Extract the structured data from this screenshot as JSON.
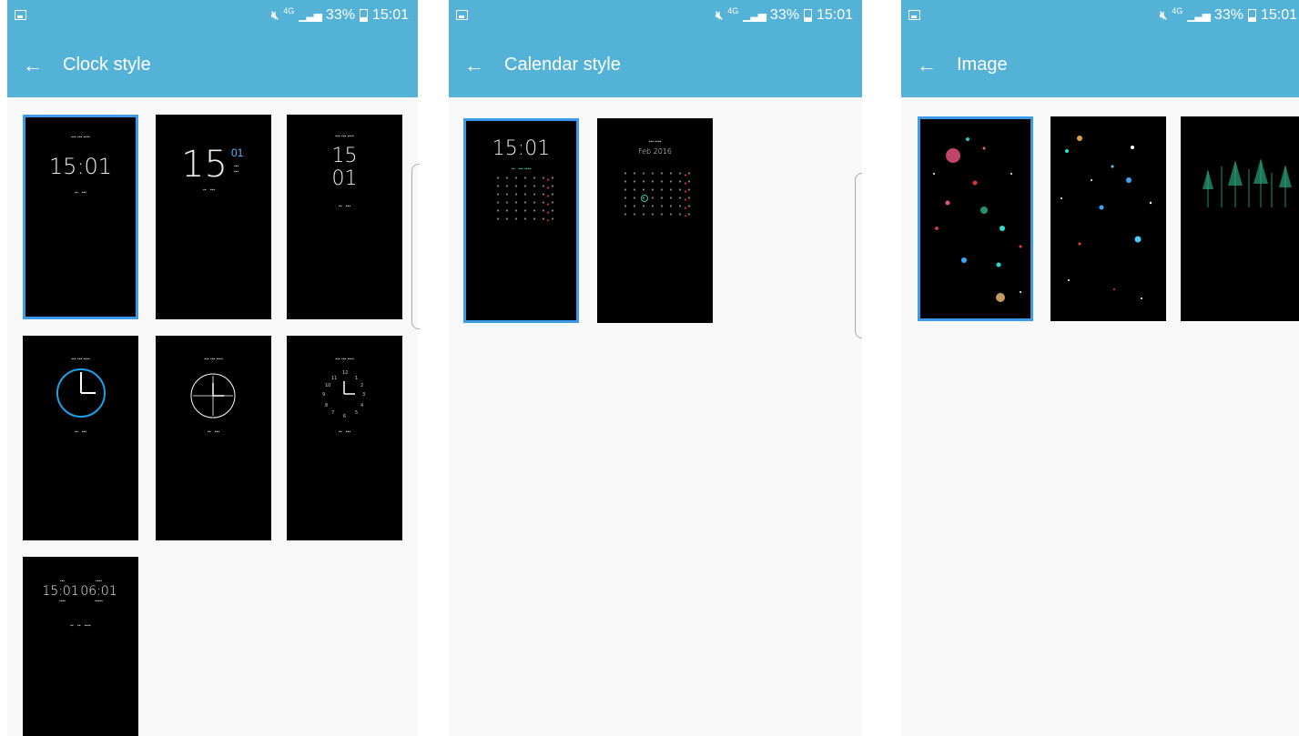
{
  "status_bar": {
    "time": "15:01",
    "battery": "33%",
    "network": "4G"
  },
  "colors": {
    "accent": "#55b2d7",
    "selection": "#3b9bea"
  },
  "screens": [
    {
      "title": "Clock style",
      "back_icon": "arrow-left-icon",
      "thumbnail_count": 7,
      "selected_index": 0
    },
    {
      "title": "Calendar style",
      "back_icon": "arrow-left-icon",
      "thumbnail_count": 2,
      "selected_index": 0
    },
    {
      "title": "Image",
      "back_icon": "arrow-left-icon",
      "thumbnail_count": 3,
      "selected_index": 0
    }
  ],
  "clock_previews": {
    "digital_time": "15:01",
    "split_hour": "15",
    "split_minute": "01",
    "dual_home": "15:01",
    "dual_world": "06:01"
  },
  "calendar_previews": {
    "time": "15:01",
    "month": "Feb 2016"
  }
}
